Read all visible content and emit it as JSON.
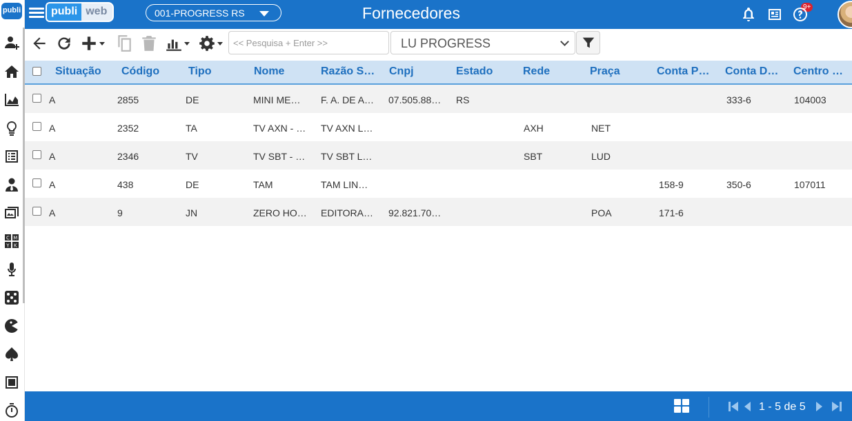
{
  "sidebar": {
    "logo_text": "publi",
    "items": [
      {
        "name": "add-user-icon"
      },
      {
        "name": "home-icon"
      },
      {
        "name": "area-chart-icon"
      },
      {
        "name": "lightbulb-icon"
      },
      {
        "name": "list-icon"
      },
      {
        "name": "person-tie-icon"
      },
      {
        "name": "media-icon"
      },
      {
        "name": "cmyk-icon"
      },
      {
        "name": "microphone-icon"
      },
      {
        "name": "dice-icon"
      },
      {
        "name": "pacman-icon"
      },
      {
        "name": "spade-icon"
      },
      {
        "name": "square-icon"
      },
      {
        "name": "stopwatch-icon"
      }
    ]
  },
  "header": {
    "brand_part1": "publi",
    "brand_part2": "web",
    "company": "001-PROGRESS RS",
    "title": "Fornecedores",
    "notifications_badge": "9+"
  },
  "toolbar": {
    "search_placeholder": "<< Pesquisa + Enter >>",
    "filter_value": "LU PROGRESS"
  },
  "grid": {
    "columns": [
      "Situação",
      "Código",
      "Tipo",
      "Nome",
      "Razão S…",
      "Cnpj",
      "Estado",
      "Rede",
      "Praça",
      "Conta P…",
      "Conta D…",
      "Centro …"
    ],
    "rows": [
      [
        "A",
        "2855",
        "DE",
        "MINI ME…",
        "F. A. DE A…",
        "07.505.88…",
        "RS",
        "",
        "",
        "",
        "333-6",
        "104003"
      ],
      [
        "A",
        "2352",
        "TA",
        "TV AXN - …",
        "TV AXN L…",
        "",
        "",
        "AXH",
        "NET",
        "",
        "",
        ""
      ],
      [
        "A",
        "2346",
        "TV",
        "TV SBT - …",
        "TV SBT L…",
        "",
        "",
        "SBT",
        "LUD",
        "",
        "",
        ""
      ],
      [
        "A",
        "438",
        "DE",
        "TAM",
        "TAM LIN…",
        "",
        "",
        "",
        "",
        "158-9",
        "350-6",
        "107011"
      ],
      [
        "A",
        "9",
        "JN",
        "ZERO HO…",
        "EDITORA…",
        "92.821.70…",
        "",
        "",
        "POA",
        "171-6",
        "",
        ""
      ]
    ]
  },
  "footer": {
    "page_info": "1 - 5 de 5"
  },
  "colors": {
    "primary": "#1a73c9",
    "header_row": "#cfe2f4",
    "header_text": "#1e6fbe",
    "alt_row": "#f2f2f2"
  }
}
